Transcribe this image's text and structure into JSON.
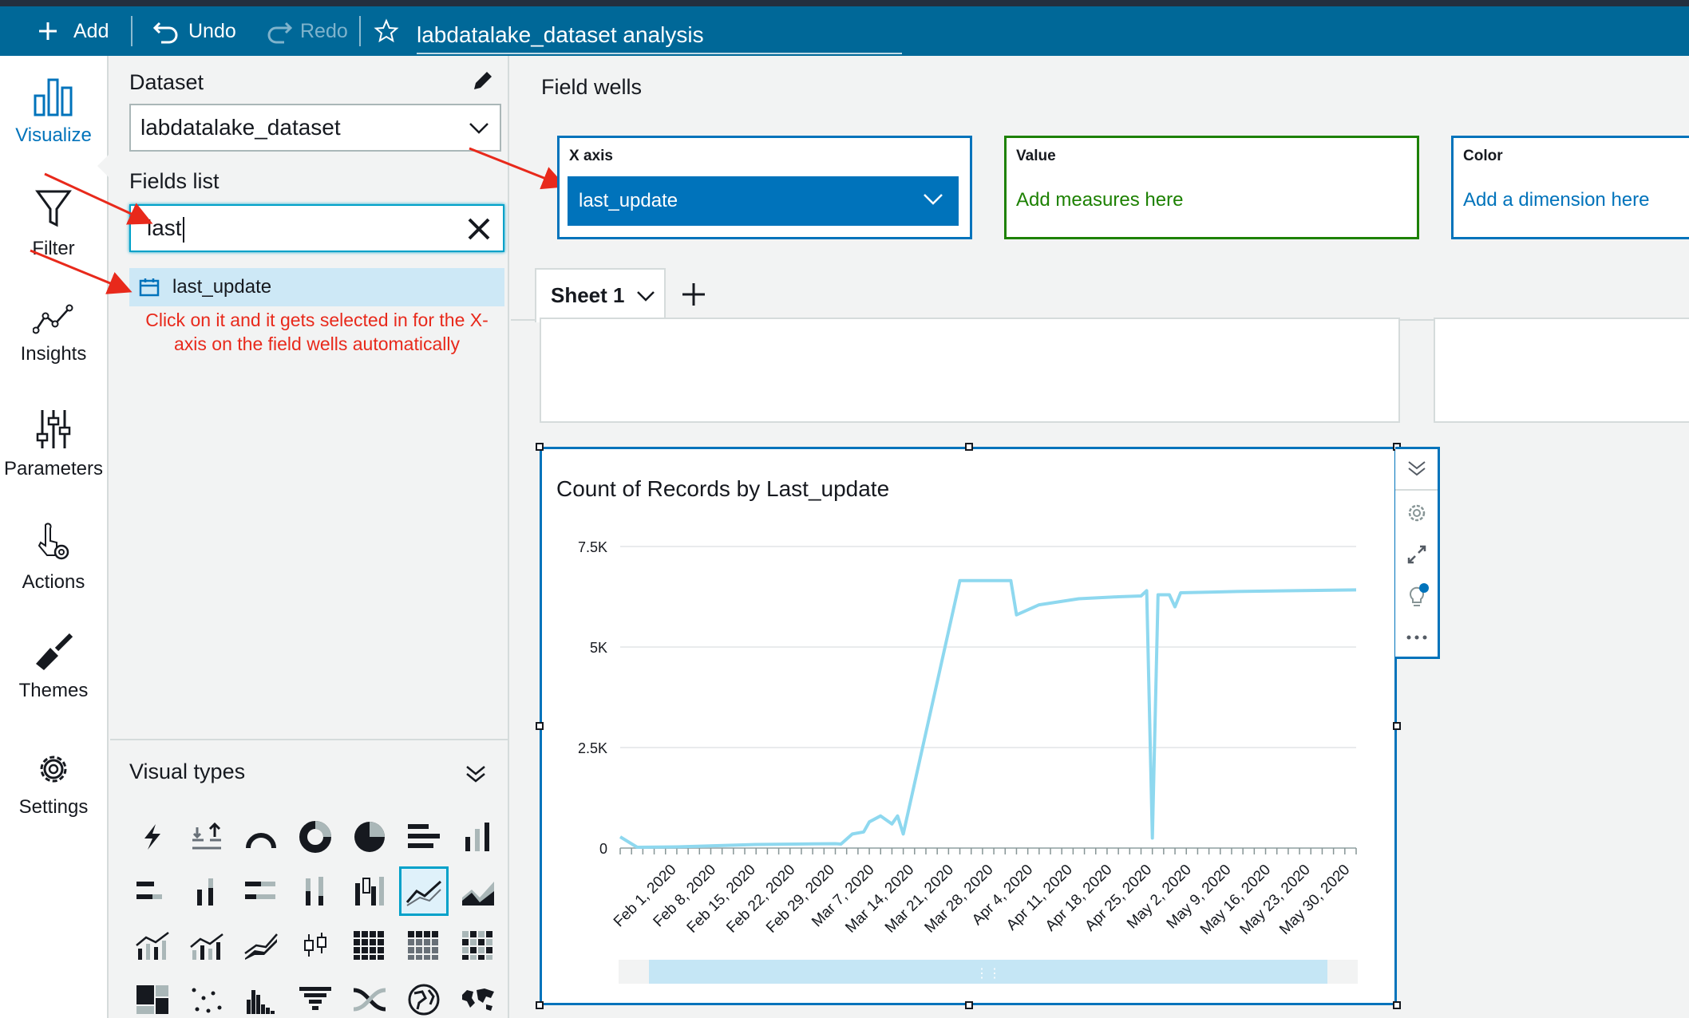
{
  "toolbar": {
    "add_label": "Add",
    "undo_label": "Undo",
    "redo_label": "Redo",
    "analysis_title": "labdatalake_dataset analysis"
  },
  "nav": {
    "items": [
      {
        "label": "Visualize",
        "icon": "bar-chart-icon",
        "active": true
      },
      {
        "label": "Filter",
        "icon": "funnel-icon"
      },
      {
        "label": "Insights",
        "icon": "insights-icon"
      },
      {
        "label": "Parameters",
        "icon": "sliders-icon"
      },
      {
        "label": "Actions",
        "icon": "pointer-gear-icon"
      },
      {
        "label": "Themes",
        "icon": "paint-brush-icon"
      },
      {
        "label": "Settings",
        "icon": "gear-icon"
      }
    ]
  },
  "panel": {
    "dataset_label": "Dataset",
    "dataset_value": "labdatalake_dataset",
    "fields_label": "Fields list",
    "search_value": "last",
    "field_result": "last_update",
    "annotation": "Click on it and it gets selected in for the X-axis on the field wells automatically",
    "visual_types_label": "Visual types"
  },
  "field_wells": {
    "title": "Field wells",
    "x_axis": {
      "label": "X axis",
      "value": "last_update"
    },
    "value": {
      "label": "Value",
      "placeholder": "Add measures here"
    },
    "color": {
      "label": "Color",
      "placeholder": "Add a dimension here"
    }
  },
  "sheet": {
    "tab_label": "Sheet 1"
  },
  "colors": {
    "topbar": "#006898",
    "accent": "#0073bb",
    "value_well": "#1d8102",
    "annotation": "#e8291b",
    "line": "#8ed8ef"
  },
  "chart_data": {
    "type": "line",
    "title": "Count of Records by Last_update",
    "ylim": [
      0,
      7500
    ],
    "y_ticks": [
      "0",
      "2.5K",
      "5K",
      "7.5K"
    ],
    "x_ticks": [
      "Feb 1, 2020",
      "Feb 8, 2020",
      "Feb 15, 2020",
      "Feb 22, 2020",
      "Feb 29, 2020",
      "Mar 7, 2020",
      "Mar 14, 2020",
      "Mar 21, 2020",
      "Mar 28, 2020",
      "Apr 4, 2020",
      "Apr 11, 2020",
      "Apr 18, 2020",
      "Apr 25, 2020",
      "May 2, 2020",
      "May 9, 2020",
      "May 16, 2020",
      "May 23, 2020",
      "May 30, 2020"
    ],
    "x": [
      "2020-01-22",
      "2020-01-25",
      "2020-02-01",
      "2020-02-08",
      "2020-02-15",
      "2020-02-22",
      "2020-02-29",
      "2020-03-01",
      "2020-03-03",
      "2020-03-05",
      "2020-03-06",
      "2020-03-08",
      "2020-03-09",
      "2020-03-10",
      "2020-03-11",
      "2020-03-12",
      "2020-03-22",
      "2020-03-31",
      "2020-04-01",
      "2020-04-05",
      "2020-04-12",
      "2020-04-19",
      "2020-04-23",
      "2020-04-24",
      "2020-04-25",
      "2020-04-26",
      "2020-04-28",
      "2020-04-29",
      "2020-04-30",
      "2020-05-10",
      "2020-05-20",
      "2020-05-31"
    ],
    "y": [
      280,
      20,
      30,
      60,
      90,
      100,
      110,
      100,
      350,
      400,
      650,
      800,
      700,
      600,
      800,
      350,
      6650,
      6650,
      5800,
      6050,
      6200,
      6250,
      6270,
      6400,
      250,
      6300,
      6300,
      6000,
      6350,
      6380,
      6400,
      6420
    ]
  }
}
